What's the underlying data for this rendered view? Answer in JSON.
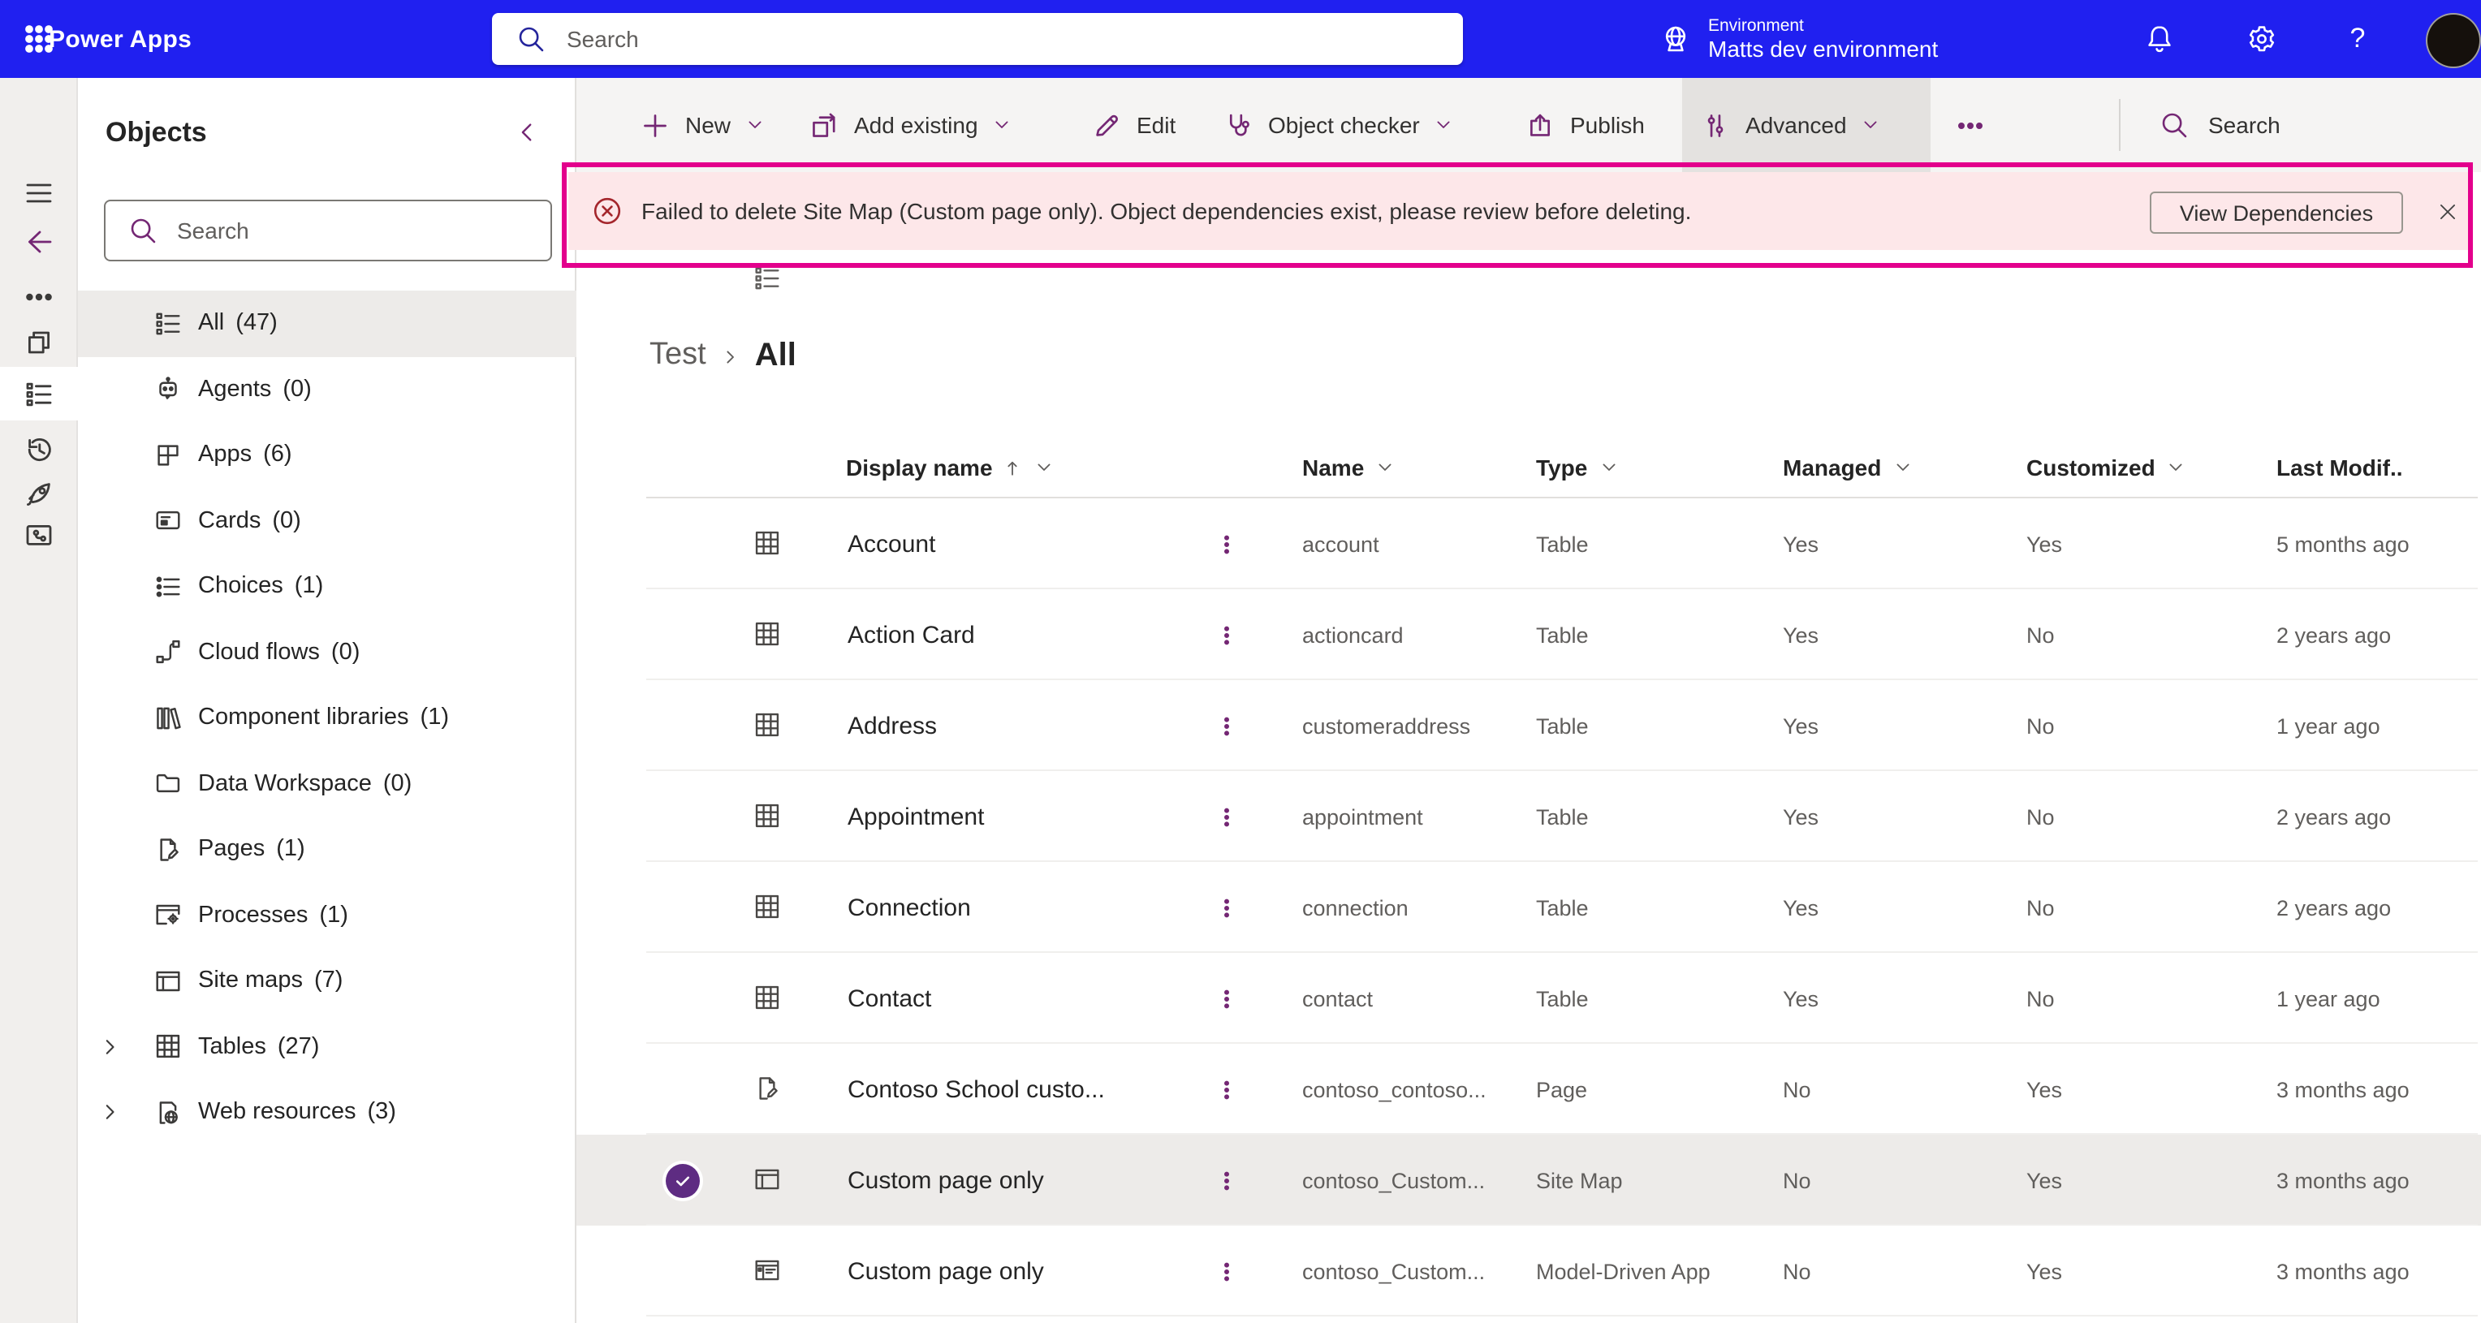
{
  "header": {
    "app_name": "Power Apps",
    "search_placeholder": "Search",
    "environment_label": "Environment",
    "environment_name": "Matts dev environment",
    "icons": [
      "waffle-icon",
      "search-icon",
      "globe-icon",
      "notifications-bell-icon",
      "settings-gear-icon",
      "help-icon",
      "avatar"
    ],
    "colors": {
      "header_background": "#2020f0"
    }
  },
  "rail": {
    "items": [
      {
        "icon": "hamburger-icon"
      },
      {
        "icon": "back-arrow-icon"
      },
      {
        "icon": "more-horizontal-icon"
      },
      {
        "icon": "stack-pages-icon"
      },
      {
        "icon": "objects-list-icon",
        "active": true
      },
      {
        "icon": "history-icon"
      },
      {
        "icon": "rocket-icon"
      },
      {
        "icon": "source-control-icon"
      }
    ]
  },
  "objects_panel": {
    "title": "Objects",
    "collapse_icon": "chevron-left-icon",
    "search_placeholder": "Search",
    "items": [
      {
        "label": "All",
        "count": "(47)",
        "icon": "objects-list-icon",
        "selected": true
      },
      {
        "label": "Agents",
        "count": "(0)",
        "icon": "agent-robot-icon"
      },
      {
        "label": "Apps",
        "count": "(6)",
        "icon": "apps-grid-icon"
      },
      {
        "label": "Cards",
        "count": "(0)",
        "icon": "card-icon"
      },
      {
        "label": "Choices",
        "count": "(1)",
        "icon": "choices-list-icon"
      },
      {
        "label": "Cloud flows",
        "count": "(0)",
        "icon": "cloud-flow-icon"
      },
      {
        "label": "Component libraries",
        "count": "(1)",
        "icon": "component-library-icon"
      },
      {
        "label": "Data Workspace",
        "count": "(0)",
        "icon": "folder-icon"
      },
      {
        "label": "Pages",
        "count": "(1)",
        "icon": "page-edit-icon"
      },
      {
        "label": "Processes",
        "count": "(1)",
        "icon": "process-gear-icon"
      },
      {
        "label": "Site maps",
        "count": "(7)",
        "icon": "sitemap-icon"
      },
      {
        "label": "Tables",
        "count": "(27)",
        "icon": "table-icon",
        "expandable": true
      },
      {
        "label": "Web resources",
        "count": "(3)",
        "icon": "web-resource-icon",
        "expandable": true
      }
    ]
  },
  "toolbar": {
    "items": [
      {
        "label": "New",
        "icon": "plus-icon",
        "has_chevron": true
      },
      {
        "label": "Add existing",
        "icon": "add-existing-icon",
        "has_chevron": true
      },
      {
        "label": "Edit",
        "icon": "edit-pencil-icon",
        "has_chevron": false
      },
      {
        "label": "Object checker",
        "icon": "stethoscope-icon",
        "has_chevron": true
      },
      {
        "label": "Publish",
        "icon": "publish-icon",
        "has_chevron": false
      },
      {
        "label": "Advanced",
        "icon": "advanced-sliders-icon",
        "has_chevron": true,
        "highlighted": true
      },
      {
        "label": "",
        "icon": "more-horizontal-icon",
        "has_chevron": false
      }
    ],
    "search_label": "Search",
    "accent_color": "#742774"
  },
  "error_banner": {
    "icon": "error-circle-icon",
    "message": "Failed to delete Site Map (Custom page only). Object dependencies exist, please review before deleting.",
    "action_label": "View Dependencies",
    "close_icon": "close-icon",
    "colors": {
      "background": "#fde7e9",
      "icon": "#a4262c",
      "highlight_border": "#e3008c"
    }
  },
  "main": {
    "breadcrumb": {
      "parent": "Test",
      "current": "All"
    },
    "table": {
      "columns": [
        {
          "label": "Display name",
          "sorted_asc": true,
          "has_chevron": true
        },
        {
          "label": "Name",
          "has_chevron": true
        },
        {
          "label": "Type",
          "has_chevron": true
        },
        {
          "label": "Managed",
          "has_chevron": true
        },
        {
          "label": "Customized",
          "has_chevron": true
        },
        {
          "label": "Last Modif..",
          "has_chevron": false
        }
      ],
      "rows": [
        {
          "icon": "table-icon",
          "display_name": "Account",
          "name": "account",
          "type": "Table",
          "managed": "Yes",
          "customized": "Yes",
          "last_modified": "5 months ago",
          "selected": false
        },
        {
          "icon": "table-icon",
          "display_name": "Action Card",
          "name": "actioncard",
          "type": "Table",
          "managed": "Yes",
          "customized": "No",
          "last_modified": "2 years ago",
          "selected": false
        },
        {
          "icon": "table-icon",
          "display_name": "Address",
          "name": "customeraddress",
          "type": "Table",
          "managed": "Yes",
          "customized": "No",
          "last_modified": "1 year ago",
          "selected": false
        },
        {
          "icon": "table-icon",
          "display_name": "Appointment",
          "name": "appointment",
          "type": "Table",
          "managed": "Yes",
          "customized": "No",
          "last_modified": "2 years ago",
          "selected": false
        },
        {
          "icon": "table-icon",
          "display_name": "Connection",
          "name": "connection",
          "type": "Table",
          "managed": "Yes",
          "customized": "No",
          "last_modified": "2 years ago",
          "selected": false
        },
        {
          "icon": "table-icon",
          "display_name": "Contact",
          "name": "contact",
          "type": "Table",
          "managed": "Yes",
          "customized": "No",
          "last_modified": "1 year ago",
          "selected": false
        },
        {
          "icon": "page-edit-icon",
          "display_name": "Contoso School custo...",
          "name": "contoso_contoso...",
          "type": "Page",
          "managed": "No",
          "customized": "Yes",
          "last_modified": "3 months ago",
          "selected": false
        },
        {
          "icon": "sitemap-icon",
          "display_name": "Custom page only",
          "name": "contoso_Custom...",
          "type": "Site Map",
          "managed": "No",
          "customized": "Yes",
          "last_modified": "3 months ago",
          "selected": true
        },
        {
          "icon": "model-driven-app-icon",
          "display_name": "Custom page only",
          "name": "contoso_Custom...",
          "type": "Model-Driven App",
          "managed": "No",
          "customized": "Yes",
          "last_modified": "3 months ago",
          "selected": false
        }
      ],
      "selection_check_color": "#5e2c82"
    }
  }
}
